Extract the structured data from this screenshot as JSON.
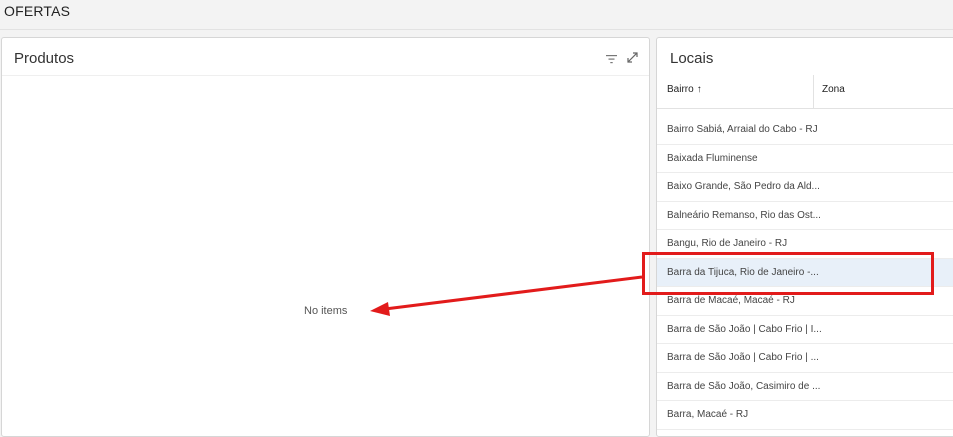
{
  "page": {
    "title": "OFERTAS"
  },
  "produtos": {
    "title": "Produtos",
    "empty_text": "No items",
    "icons": [
      "filter-icon",
      "expand-icon"
    ]
  },
  "locais": {
    "title": "Locais",
    "columns": {
      "bairro": "Bairro",
      "zona": "Zona"
    },
    "sort_indicator": "↑",
    "rows": [
      "Bairro Sabiá, Arraial do Cabo - RJ",
      "Baixada Fluminense",
      "Baixo Grande, São Pedro da Ald...",
      "Balneário Remanso, Rio das Ost...",
      "Bangu, Rio de Janeiro - RJ",
      "Barra da Tijuca, Rio de Janeiro -...",
      "Barra de Macaé, Macaé - RJ",
      "Barra de São João | Cabo Frio | I...",
      "Barra de São João | Cabo Frio | ...",
      "Barra de São João, Casimiro de ...",
      "Barra, Macaé - RJ"
    ],
    "selected_row_index": 5
  },
  "colors": {
    "annotation": "#e21b1b",
    "selected_row": "#e8f0f9"
  }
}
